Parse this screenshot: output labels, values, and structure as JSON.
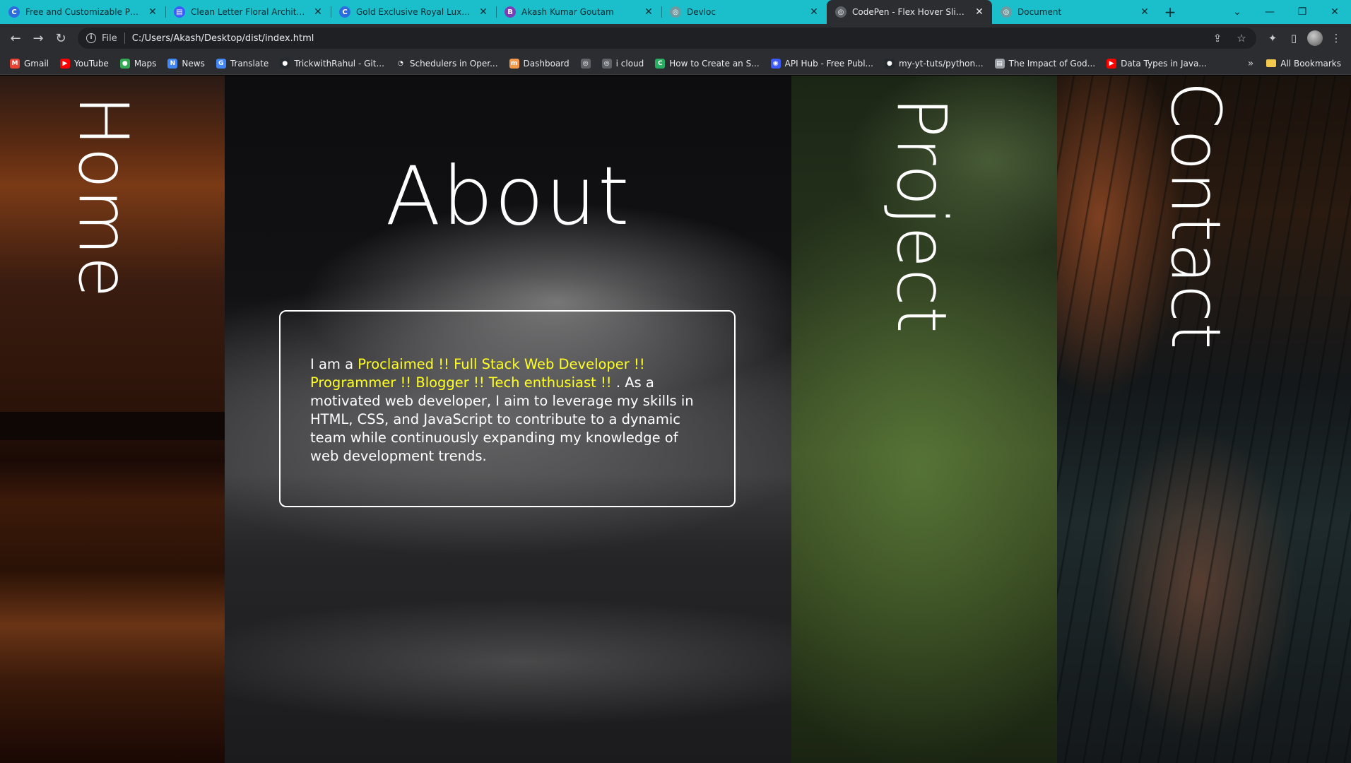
{
  "tabs": [
    {
      "title": "Free and Customizable Professi",
      "icon": "canva-icon",
      "color": "#2d6cdf",
      "glyph": "C",
      "active": false
    },
    {
      "title": "Clean Letter Floral Architecture",
      "icon": "document-icon",
      "color": "#3d5afe",
      "glyph": "▤",
      "active": false
    },
    {
      "title": "Gold Exclusive Royal Luxury Ho",
      "icon": "canva-icon",
      "color": "#2d6cdf",
      "glyph": "C",
      "active": false
    },
    {
      "title": "Akash Kumar Goutam",
      "icon": "bootstrap-icon",
      "color": "#7a3fb8",
      "glyph": "B",
      "active": false
    },
    {
      "title": "Devloc",
      "icon": "globe-icon",
      "color": "#6e9aa0",
      "glyph": "◎",
      "active": false
    },
    {
      "title": "CodePen - Flex Hover Slider | H",
      "icon": "globe-icon",
      "color": "#5f6368",
      "glyph": "◎",
      "active": true
    },
    {
      "title": "Document",
      "icon": "globe-icon",
      "color": "#6e9aa0",
      "glyph": "◎",
      "active": false
    }
  ],
  "toolbar": {
    "scheme": "File",
    "url": "C:/Users/Akash/Desktop/dist/index.html"
  },
  "bookmarks": [
    {
      "label": "Gmail",
      "icon": "gmail-icon",
      "color": "#ea4335",
      "glyph": "M"
    },
    {
      "label": "YouTube",
      "icon": "youtube-icon",
      "color": "#ff0000",
      "glyph": "▶"
    },
    {
      "label": "Maps",
      "icon": "maps-icon",
      "color": "#34a853",
      "glyph": "●"
    },
    {
      "label": "News",
      "icon": "news-icon",
      "color": "#4285f4",
      "glyph": "N"
    },
    {
      "label": "Translate",
      "icon": "translate-icon",
      "color": "#4285f4",
      "glyph": "G"
    },
    {
      "label": "TrickwithRahul - Git...",
      "icon": "github-icon",
      "color": "#24292e",
      "glyph": "●"
    },
    {
      "label": "Schedulers in Oper...",
      "icon": "loading-icon",
      "color": "#2b2d30",
      "glyph": "◔"
    },
    {
      "label": "Dashboard",
      "icon": "dashboard-icon",
      "color": "#f2994a",
      "glyph": "m"
    },
    {
      "label": "",
      "icon": "globe-icon",
      "color": "#5f6368",
      "glyph": "◎"
    },
    {
      "label": "i cloud",
      "icon": "globe-icon",
      "color": "#5f6368",
      "glyph": "◎"
    },
    {
      "label": "How to Create an S...",
      "icon": "codepen-icon",
      "color": "#27ae60",
      "glyph": "C"
    },
    {
      "label": "API Hub - Free Publ...",
      "icon": "api-hub-icon",
      "color": "#3d5afe",
      "glyph": "◉"
    },
    {
      "label": "my-yt-tuts/python...",
      "icon": "github-icon",
      "color": "#24292e",
      "glyph": "●"
    },
    {
      "label": "The Impact of God...",
      "icon": "document-icon",
      "color": "#9aa0a6",
      "glyph": "▤"
    },
    {
      "label": "Data Types in Java...",
      "icon": "youtube-icon",
      "color": "#ff0000",
      "glyph": "▶"
    }
  ],
  "bookmarks_overflow": "»",
  "all_bookmarks": "All Bookmarks",
  "panels": {
    "home": "Home",
    "about": {
      "title": "About",
      "intro": "I am a ",
      "highlight": "Proclaimed !! Full Stack Web Developer !! Programmer !! Blogger !! Tech enthusiast !! ",
      "body": ". As a motivated web developer, I aim to leverage my skills in HTML, CSS, and JavaScript to contribute to a dynamic team while continuously expanding my knowledge of web development trends."
    },
    "project": "Project",
    "contact": "Contact"
  },
  "colors": {
    "tab_strip": "#1bbfcc",
    "chrome": "#2b2d30",
    "highlight_text": "#ffff21"
  }
}
